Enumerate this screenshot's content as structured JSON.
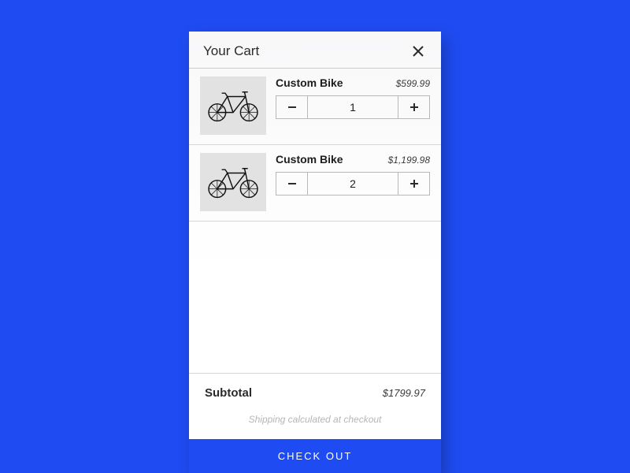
{
  "header": {
    "title": "Your Cart"
  },
  "items": [
    {
      "name": "Custom Bike",
      "price": "$599.99",
      "qty": "1"
    },
    {
      "name": "Custom Bike",
      "price": "$1,199.98",
      "qty": "2"
    }
  ],
  "subtotal": {
    "label": "Subtotal",
    "value": "$1799.97"
  },
  "shipping_note": "Shipping calculated at checkout",
  "checkout_label": "CHECK OUT"
}
